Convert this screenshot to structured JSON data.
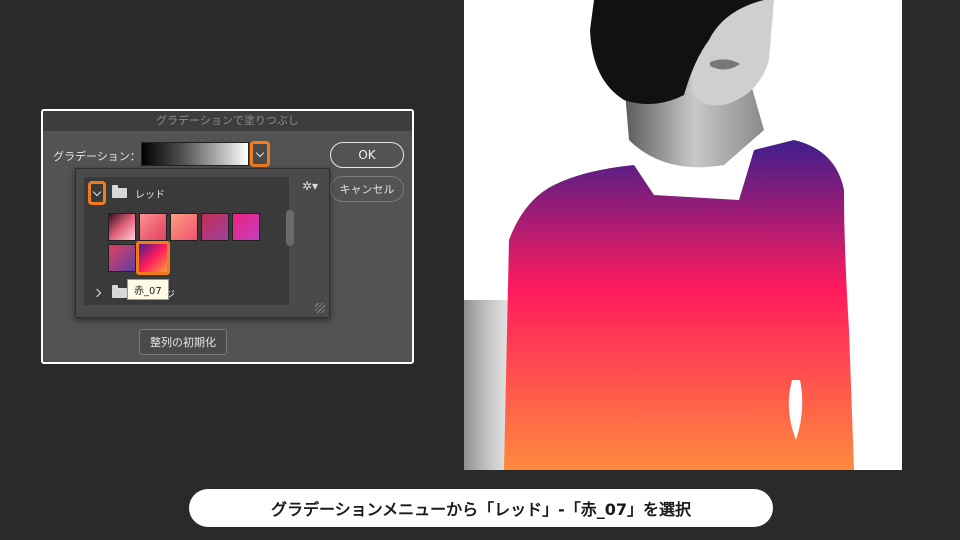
{
  "dialog": {
    "title": "グラデーションで塗りつぶし",
    "gradient_label": "グラデーション：",
    "ok_label": "OK",
    "cancel_label": "キャンセル",
    "reset_label": "整列の初期化"
  },
  "picker": {
    "folders": [
      {
        "name": "レッド",
        "expanded": true
      },
      {
        "name": "オレンジ",
        "expanded": false
      }
    ],
    "tooltip": "赤_07",
    "gear_icon": "gear-icon"
  },
  "caption": "グラデーションメニューから「レッド」-「赤_07」を選択",
  "colors": {
    "highlight": "#f07c1e",
    "grad_top": "#4a1f8a",
    "grad_mid": "#ff1a5e",
    "grad_bottom": "#ff8a3d"
  }
}
